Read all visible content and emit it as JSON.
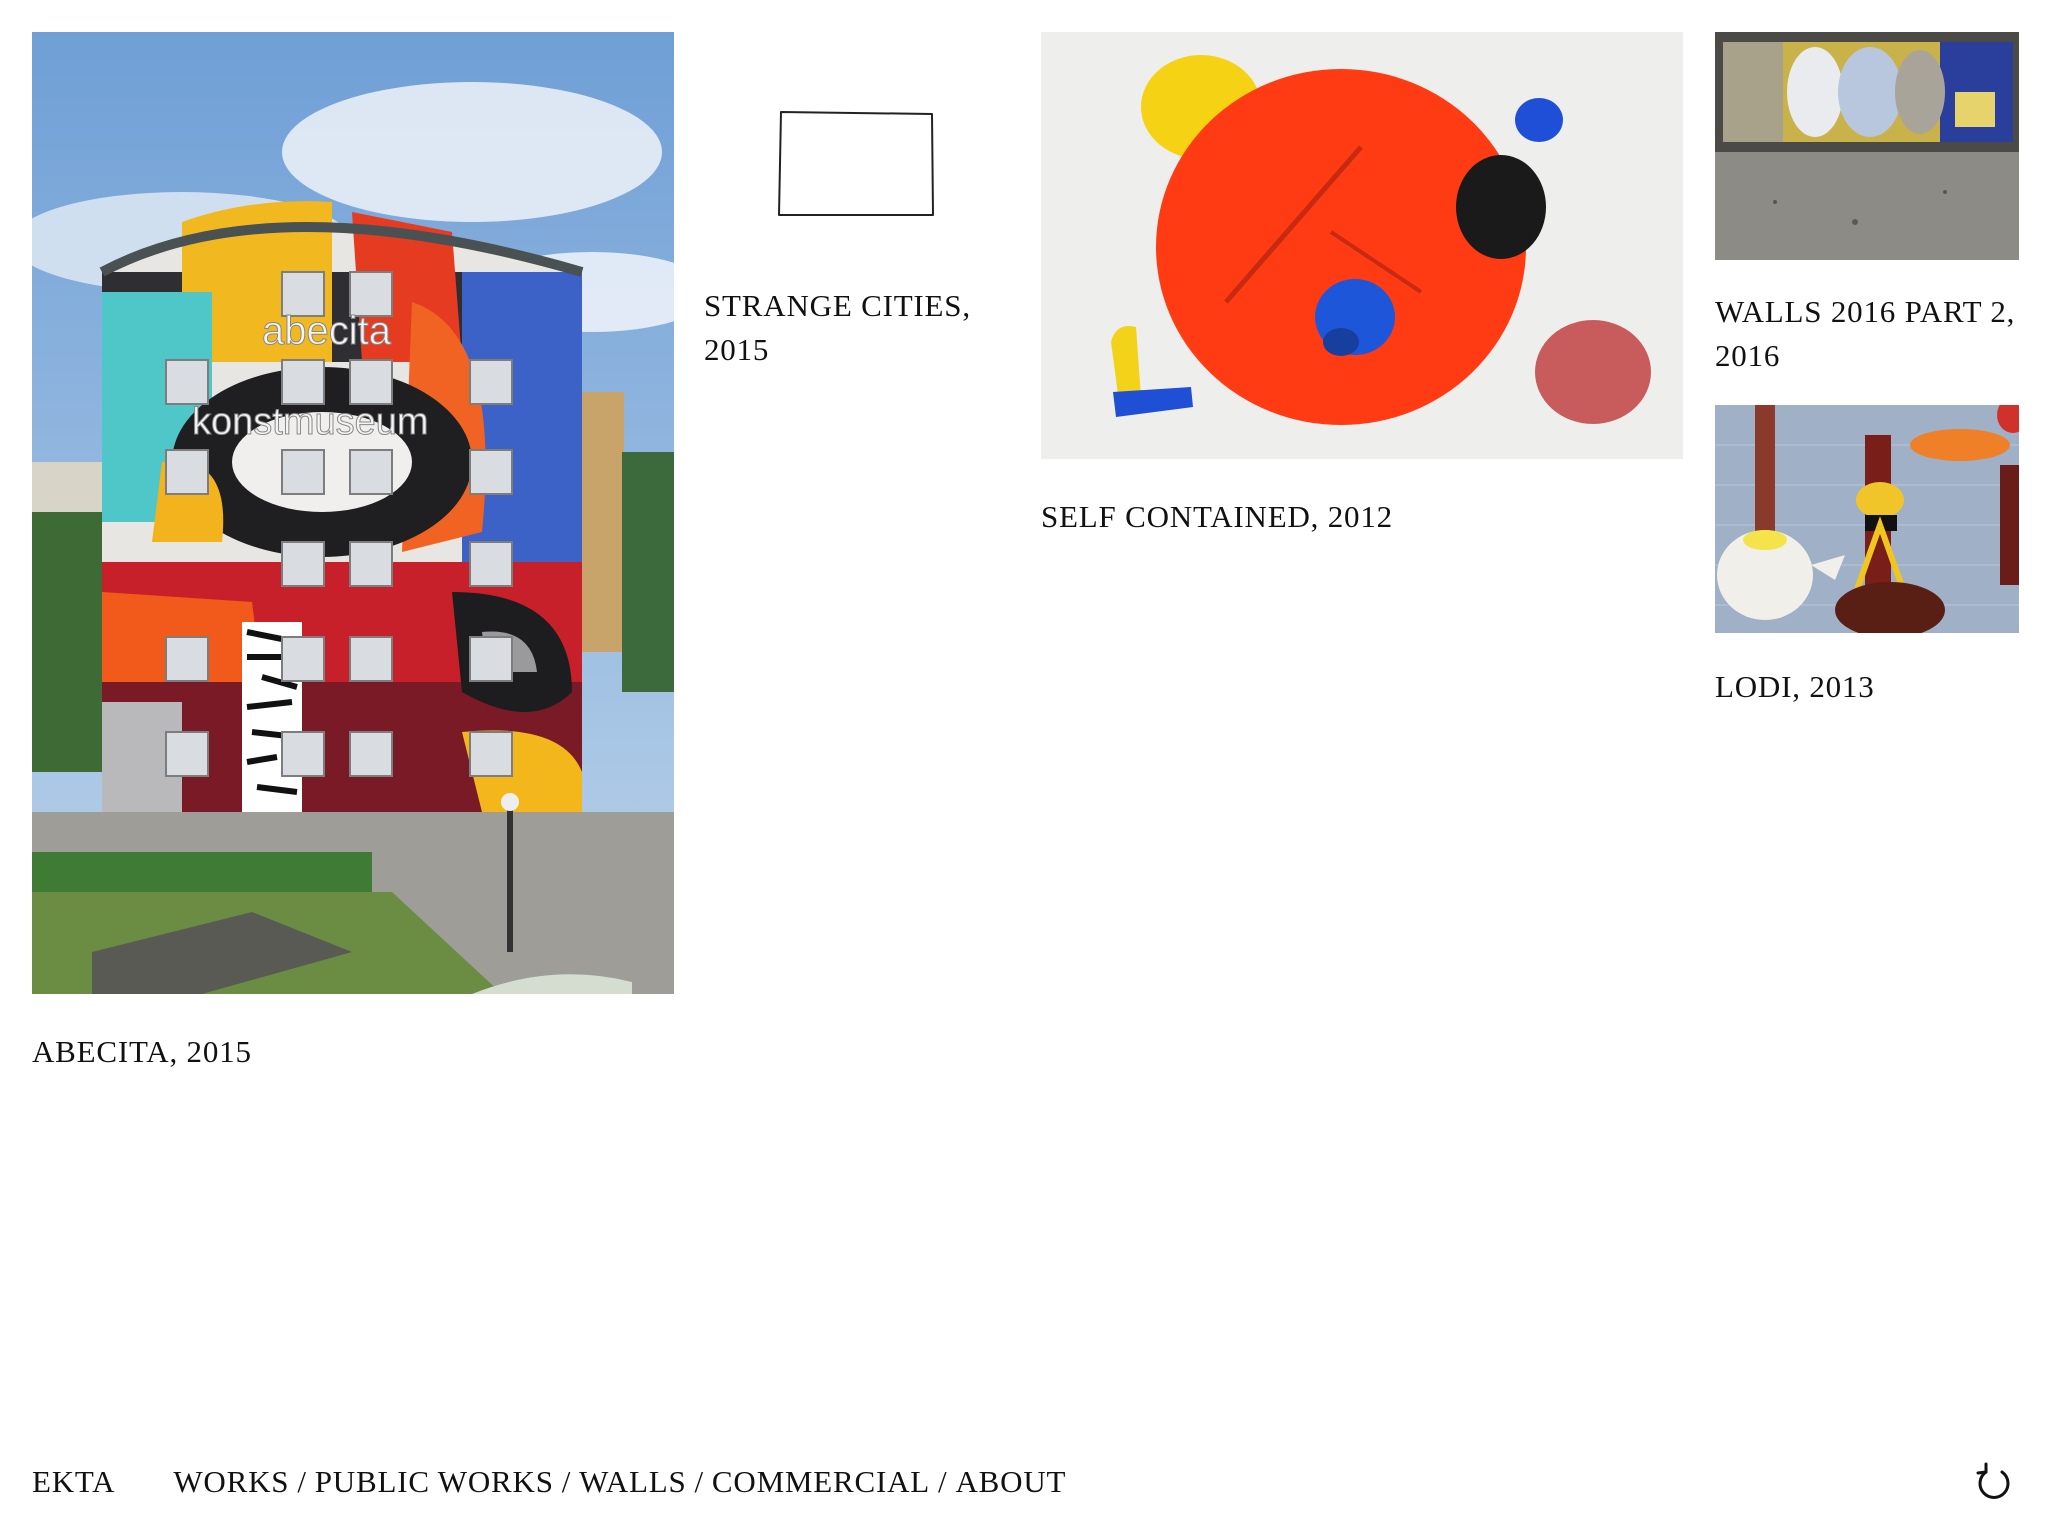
{
  "works": [
    {
      "id": "abecita",
      "title": "ABECITA, 2015",
      "image_text": [
        "abecita",
        "konstmuseum"
      ]
    },
    {
      "id": "strange",
      "title": "STRANGE CITIES, 2015"
    },
    {
      "id": "self",
      "title": "SELF CONTAINED, 2012"
    },
    {
      "id": "walls",
      "title": "WALLS 2016 PART 2, 2016"
    },
    {
      "id": "lodi",
      "title": "LODI, 2013"
    }
  ],
  "footer": {
    "brand": "EKTA",
    "separator": "/",
    "nav": [
      "WORKS",
      "PUBLIC WORKS",
      "WALLS",
      "COMMERCIAL",
      "ABOUT"
    ],
    "reload_icon": "reload-icon"
  }
}
